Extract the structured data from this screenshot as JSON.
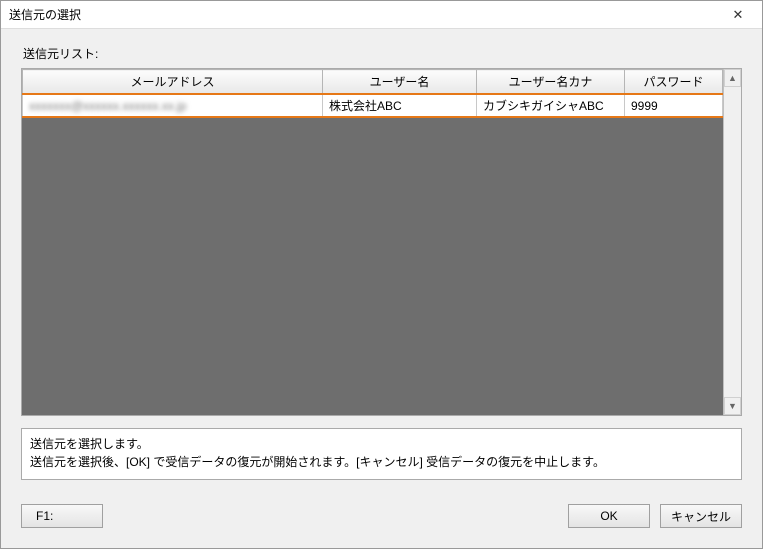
{
  "window": {
    "title": "送信元の選択"
  },
  "list_label": "送信元リスト:",
  "columns": [
    "メールアドレス",
    "ユーザー名",
    "ユーザー名カナ",
    "パスワード"
  ],
  "rows": [
    {
      "email": "xxxxxxx@xxxxxx.xxxxxx.xx.jp",
      "email_obscured": true,
      "user_name": "株式会社ABC",
      "user_name_kana": "カブシキガイシャABC",
      "password": "9999"
    }
  ],
  "info": {
    "line1": "送信元を選択します。",
    "line2": "送信元を選択後、[OK] で受信データの復元が開始されます。[キャンセル] 受信データの復元を中止します。"
  },
  "buttons": {
    "f1": "F1:",
    "ok": "OK",
    "cancel": "キャンセル"
  }
}
